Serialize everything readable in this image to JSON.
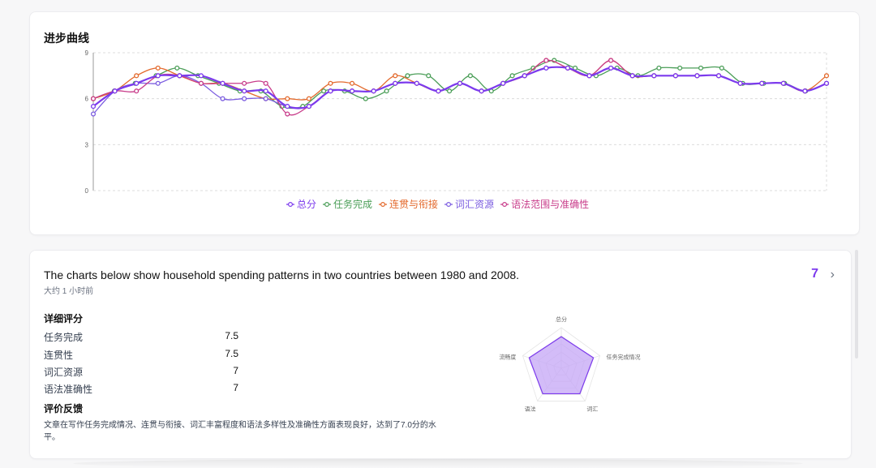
{
  "progress_card": {
    "title": "进步曲线"
  },
  "chart_data": {
    "type": "line",
    "title": "进步曲线",
    "xlabel": "",
    "ylabel": "",
    "ylim": [
      0,
      9
    ],
    "yticks": [
      0,
      3,
      6,
      9
    ],
    "grid": true,
    "legend_position": "bottom-center",
    "x": [
      1,
      2,
      3,
      4,
      5,
      6,
      7,
      8,
      9,
      10,
      11,
      12,
      13,
      14,
      15,
      16,
      17,
      18,
      19,
      20,
      21,
      22,
      23,
      24,
      25,
      26,
      27,
      28,
      29,
      30,
      31,
      32,
      33,
      34,
      35,
      36,
      37
    ],
    "series": [
      {
        "name": "总分",
        "color": "#7c3aed",
        "width": 2.2,
        "values": [
          5.5,
          6.5,
          7,
          7.5,
          7.5,
          7.5,
          7,
          6.5,
          6.5,
          5.5,
          5.5,
          6.5,
          6.5,
          6.5,
          7,
          7,
          6.5,
          7,
          6.5,
          7,
          7.5,
          8,
          8,
          7.5,
          8,
          7.5,
          7.5,
          7.5,
          7.5,
          7.5,
          7,
          7,
          7,
          6.5,
          7
        ]
      },
      {
        "name": "任务完成",
        "color": "#4b9e58",
        "width": 1.3,
        "values": [
          6,
          6.5,
          7,
          7.5,
          8,
          7.5,
          7,
          6.5,
          6.5,
          5.5,
          5.5,
          6.5,
          6.5,
          6,
          6.5,
          7.5,
          7.5,
          6.5,
          7.5,
          6.5,
          7.5,
          8,
          8.5,
          8,
          7.5,
          8,
          7.5,
          8,
          8,
          8,
          8,
          7,
          7,
          7,
          6.5,
          7
        ]
      },
      {
        "name": "连贯与衔接",
        "color": "#e3692c",
        "width": 1.3,
        "values": [
          6,
          6.5,
          7.5,
          8,
          7.5,
          7,
          7,
          6.5,
          6,
          6,
          6,
          7,
          7,
          6.5,
          7.5,
          7,
          6.5,
          7,
          6.5,
          7,
          7.5,
          8.5,
          8,
          7.5,
          8.5,
          7.5,
          7.5,
          7.5,
          7.5,
          7.5,
          7,
          7,
          7,
          6.5,
          7.5
        ]
      },
      {
        "name": "词汇资源",
        "color": "#7b5ce0",
        "width": 1.3,
        "values": [
          5,
          6.5,
          7,
          7,
          7.5,
          7,
          6,
          6,
          6,
          5.5,
          5.5,
          6.5,
          6.5,
          6.5,
          7,
          7,
          6.5,
          7,
          6.5,
          7,
          7.5,
          8,
          8,
          7.5,
          8,
          7.5,
          7.5,
          7.5,
          7.5,
          7.5,
          7,
          7,
          7,
          6.5,
          7
        ]
      },
      {
        "name": "语法范围与准确性",
        "color": "#c83c8a",
        "width": 1.3,
        "values": [
          6,
          6.5,
          6.5,
          7.5,
          7.5,
          7,
          7,
          7,
          7,
          5,
          5.5,
          6.5,
          6.5,
          6.5,
          7,
          7,
          6.5,
          7,
          6.5,
          7,
          7.5,
          8.5,
          8,
          7.5,
          8.5,
          7.5,
          7.5,
          7.5,
          7.5,
          7.5,
          7,
          7,
          7,
          6.5,
          7
        ]
      }
    ]
  },
  "essay": {
    "title": "The charts below show household spending patterns in two countries between 1980 and 2008.",
    "time": "大约 1 小时前",
    "score": "7",
    "chevron": "›",
    "detail_heading": "详细评分",
    "scores": [
      {
        "label": "任务完成",
        "value": "7.5"
      },
      {
        "label": "连贯性",
        "value": "7.5"
      },
      {
        "label": "词汇资源",
        "value": "7"
      },
      {
        "label": "语法准确性",
        "value": "7"
      }
    ],
    "feedback_heading": "评价反馈",
    "feedback": "文章在写作任务完成情况、连贯与衔接、词汇丰富程度和语法多样性及准确性方面表现良好，达到了7.0分的水平。"
  },
  "radar": {
    "axes": [
      "总分",
      "任务完成情况",
      "词汇",
      "语法",
      "流畅度"
    ],
    "values": [
      7,
      7.5,
      7,
      7,
      7.5
    ],
    "max": 9,
    "fill": "#c4a6f5",
    "stroke": "#7c3aed"
  }
}
